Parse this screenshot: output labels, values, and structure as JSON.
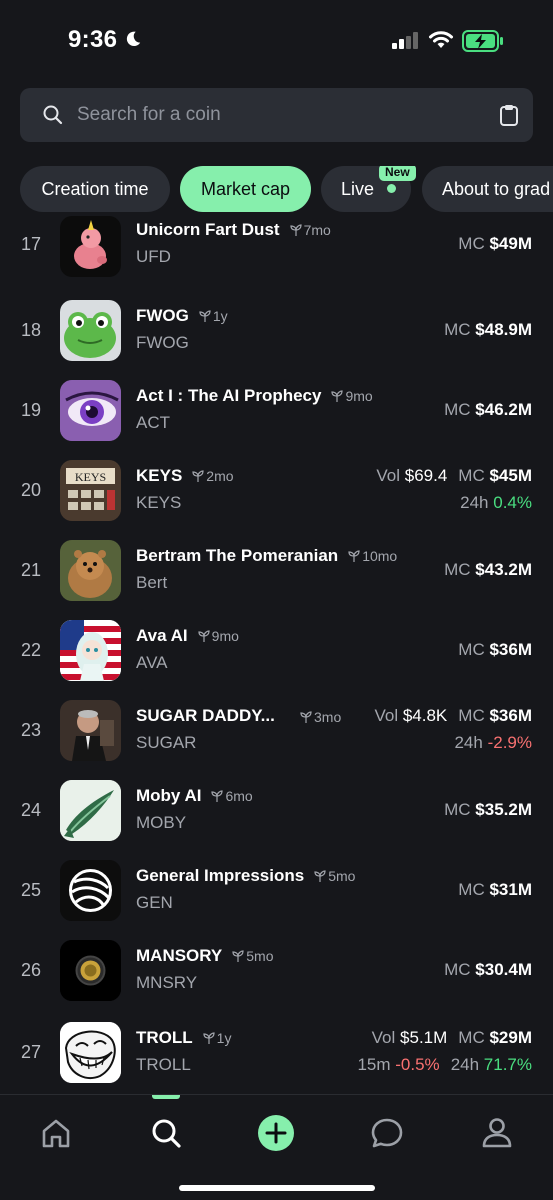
{
  "status_bar": {
    "time": "9:36",
    "battery_color": "#4ade80"
  },
  "search": {
    "placeholder": "Search for a coin",
    "value": ""
  },
  "filters": {
    "items": [
      {
        "label": "Creation time",
        "active": false
      },
      {
        "label": "Market cap",
        "active": true
      },
      {
        "label": "Live",
        "active": false,
        "badge": "New"
      },
      {
        "label": "About to grad",
        "active": false
      }
    ]
  },
  "coins": [
    {
      "rank": "17",
      "name": "Unicorn Fart Dust",
      "age": "7mo",
      "ticker": "UFD",
      "mc_label": "MC",
      "mc": "$49M"
    },
    {
      "rank": "18",
      "name": "FWOG",
      "age": "1y",
      "ticker": "FWOG",
      "mc_label": "MC",
      "mc": "$48.9M"
    },
    {
      "rank": "19",
      "name": "Act I : The AI Prophecy",
      "age": "9mo",
      "ticker": "ACT",
      "mc_label": "MC",
      "mc": "$46.2M"
    },
    {
      "rank": "20",
      "name": "KEYS",
      "age": "2mo",
      "ticker": "KEYS",
      "vol_label": "Vol",
      "vol": "$69.4",
      "mc_label": "MC",
      "mc": "$45M",
      "change_24h_label": "24h",
      "change_24h": "0.4%"
    },
    {
      "rank": "21",
      "name": "Bertram The Pomeranian",
      "age": "10mo",
      "ticker": "Bert",
      "mc_label": "MC",
      "mc": "$43.2M"
    },
    {
      "rank": "22",
      "name": "Ava AI",
      "age": "9mo",
      "ticker": "AVA",
      "mc_label": "MC",
      "mc": "$36M"
    },
    {
      "rank": "23",
      "name": "SUGAR DADDY...",
      "age": "3mo",
      "ticker": "SUGAR",
      "vol_label": "Vol",
      "vol": "$4.8K",
      "mc_label": "MC",
      "mc": "$36M",
      "change_24h_label": "24h",
      "change_24h": "-2.9%"
    },
    {
      "rank": "24",
      "name": "Moby AI",
      "age": "6mo",
      "ticker": "MOBY",
      "mc_label": "MC",
      "mc": "$35.2M"
    },
    {
      "rank": "25",
      "name": "General Impressions",
      "age": "5mo",
      "ticker": "GEN",
      "mc_label": "MC",
      "mc": "$31M"
    },
    {
      "rank": "26",
      "name": "MANSORY",
      "age": "5mo",
      "ticker": "MNSRY",
      "mc_label": "MC",
      "mc": "$30.4M"
    },
    {
      "rank": "27",
      "name": "TROLL",
      "age": "1y",
      "ticker": "TROLL",
      "vol_label": "Vol",
      "vol": "$5.1M",
      "mc_label": "MC",
      "mc": "$29M",
      "change_15m_label": "15m",
      "change_15m": "-0.5%",
      "change_24h_label": "24h",
      "change_24h": "71.7%"
    }
  ],
  "tab_bar": {
    "items": [
      {
        "icon": "home-icon"
      },
      {
        "icon": "search-icon",
        "active": true
      },
      {
        "icon": "plus-icon"
      },
      {
        "icon": "chat-icon"
      },
      {
        "icon": "profile-icon"
      }
    ]
  },
  "colors": {
    "background": "#16171b",
    "accent": "#86efac",
    "positive": "#4ade80",
    "negative": "#f87171"
  }
}
